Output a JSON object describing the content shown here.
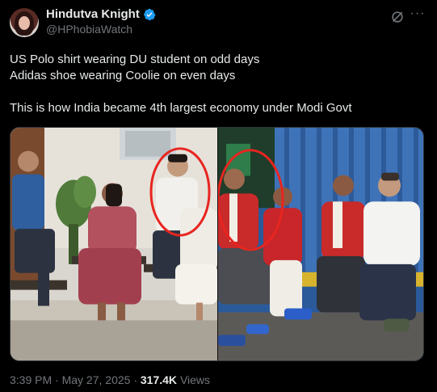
{
  "author": {
    "display_name": "Hindutva Knight",
    "handle": "@HPhobiaWatch",
    "verified": true
  },
  "tweet": {
    "lines": [
      "US Polo shirt wearing DU student on odd days",
      "Adidas shoe wearing Coolie on even days",
      "",
      "This is how India became 4th largest economy under Modi Govt"
    ]
  },
  "media": {
    "images": [
      "left-photo",
      "right-photo"
    ],
    "annotation_color": "#e8251f"
  },
  "meta": {
    "time": "3:39 PM",
    "separator": "·",
    "date": "May 27, 2025",
    "views_count": "317.4K",
    "views_label": "Views"
  },
  "icons": {
    "verified": "verified-badge-icon",
    "grok": "grok-icon",
    "more": "more-icon"
  },
  "colors": {
    "background": "#000000",
    "text": "#e7e9ea",
    "muted": "#71767b",
    "verified_blue": "#1d9bf0"
  }
}
